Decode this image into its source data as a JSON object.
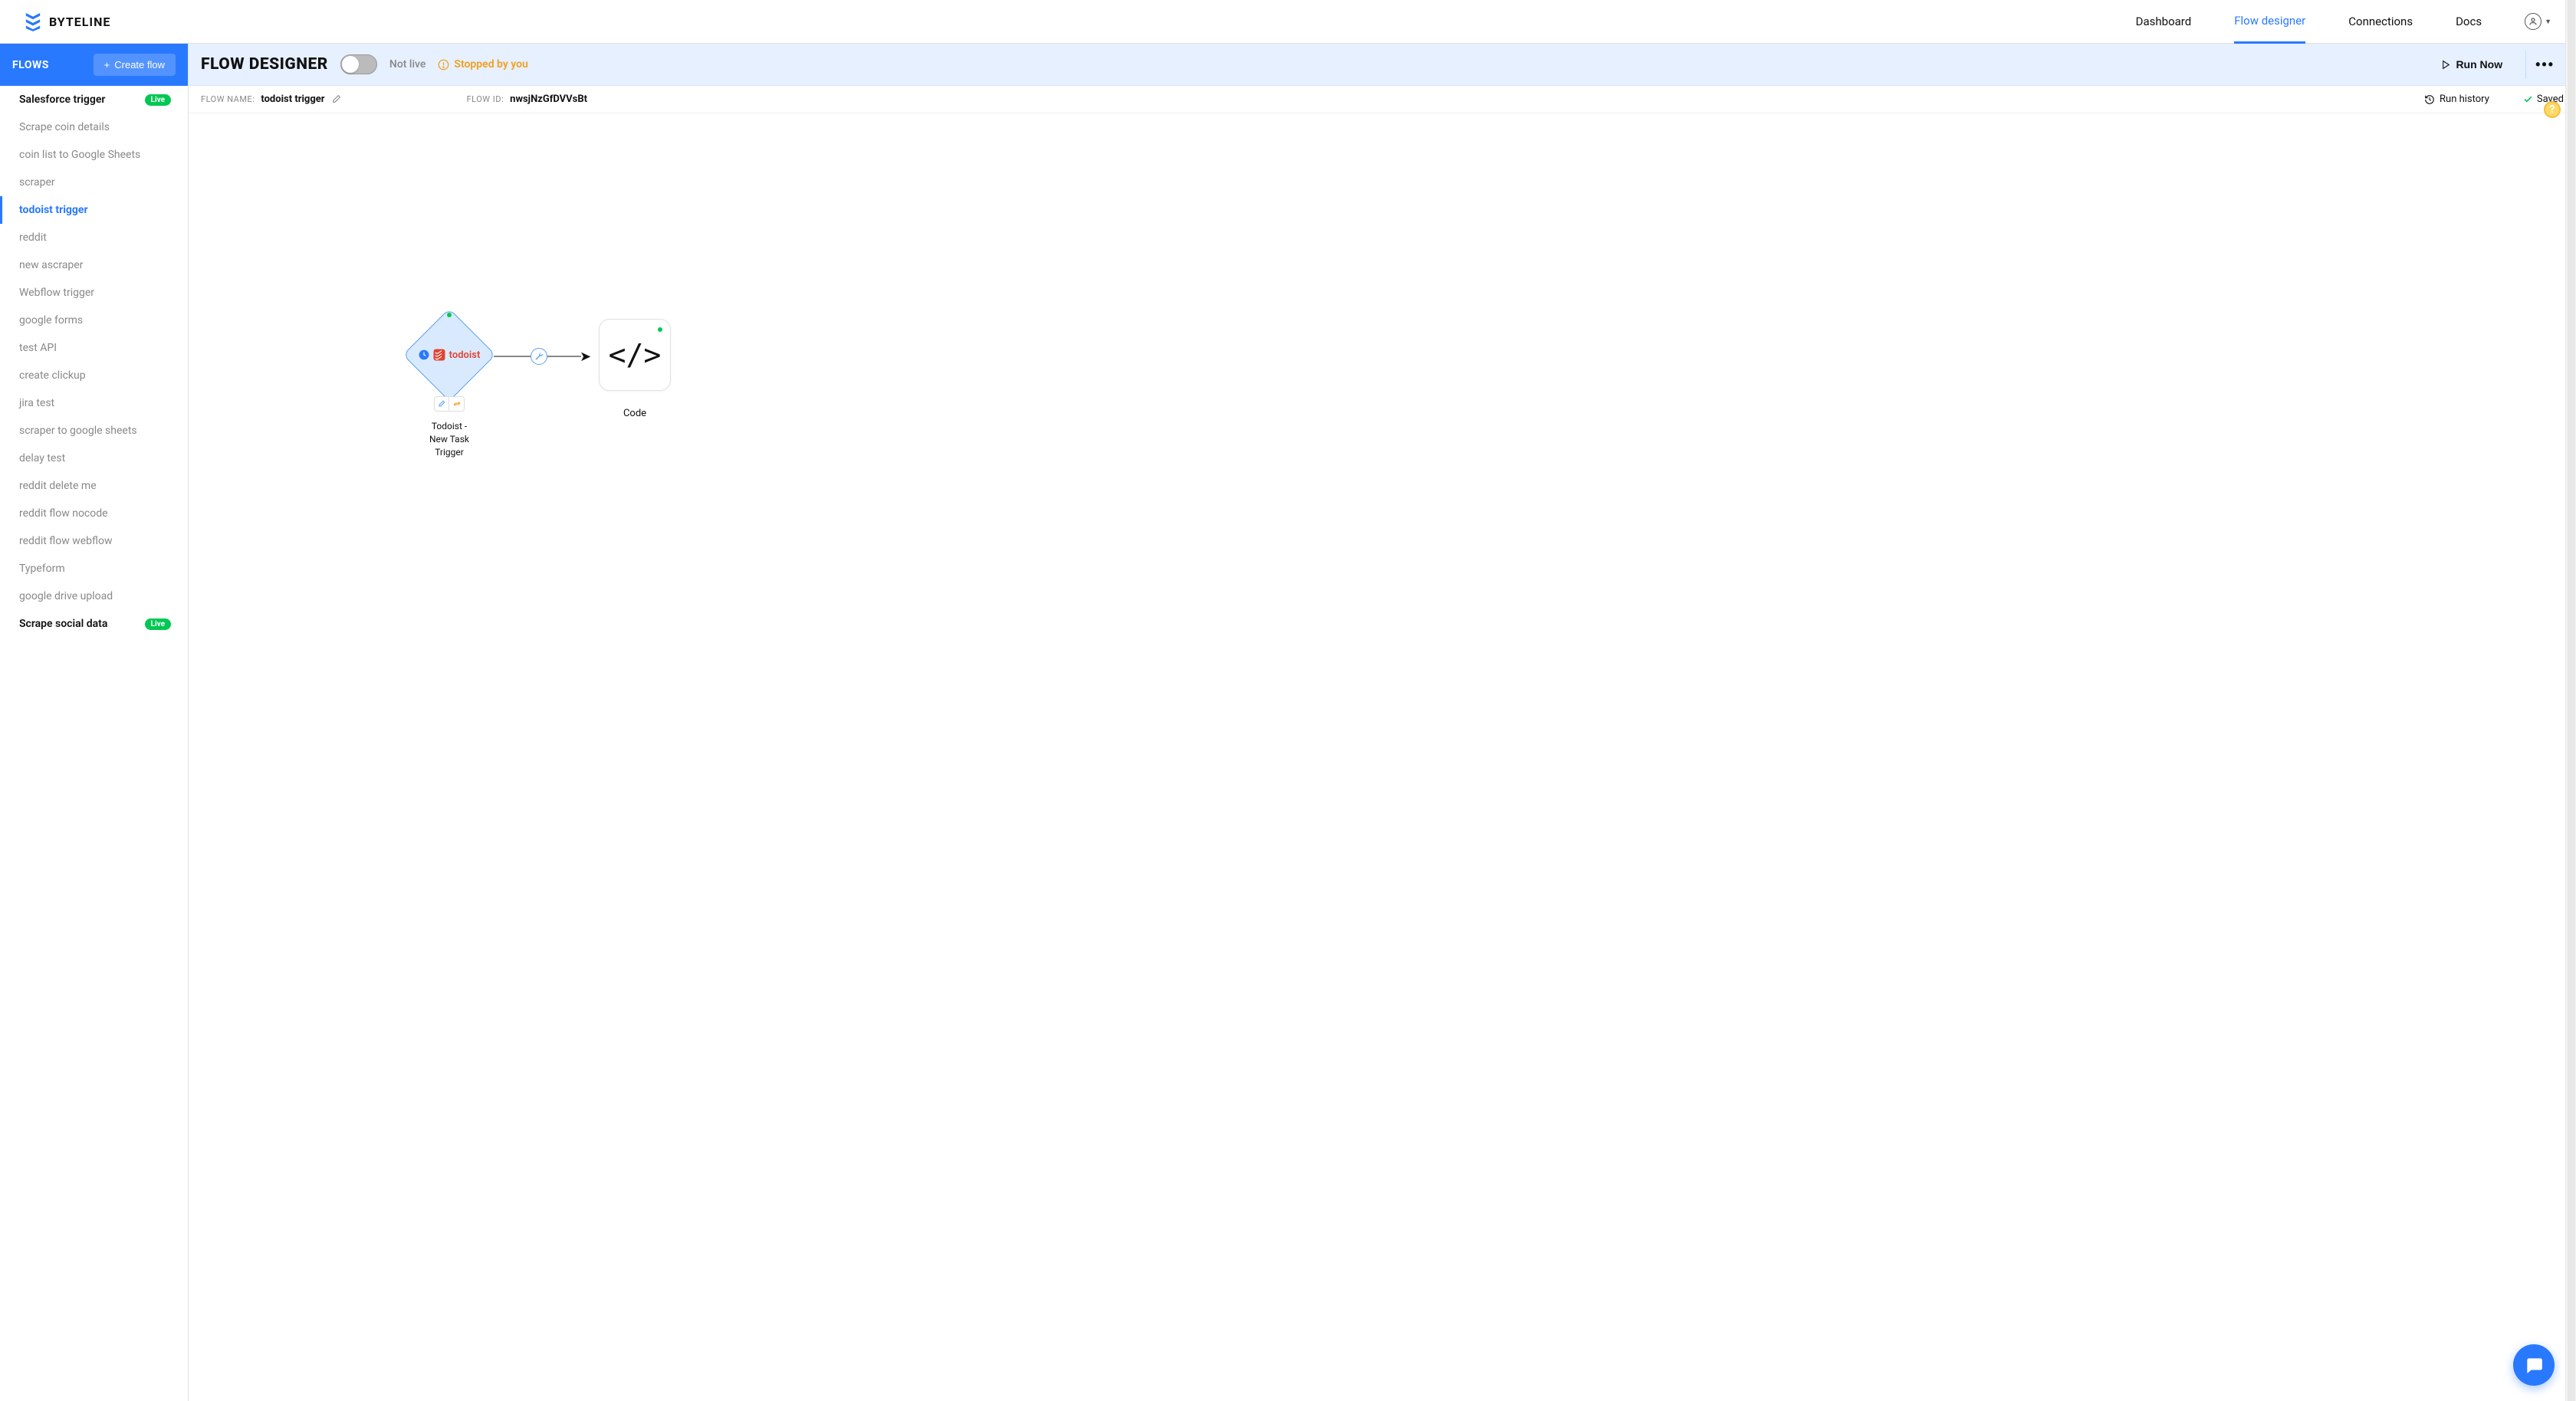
{
  "brand": {
    "name": "BYTELINE"
  },
  "nav": {
    "items": [
      {
        "label": "Dashboard",
        "active": false
      },
      {
        "label": "Flow designer",
        "active": true
      },
      {
        "label": "Connections",
        "active": false
      },
      {
        "label": "Docs",
        "active": false
      }
    ]
  },
  "sidebar": {
    "title": "FLOWS",
    "create_label": "Create flow",
    "items": [
      {
        "label": "Salesforce trigger",
        "live": true,
        "bold": true,
        "active": false
      },
      {
        "label": "Scrape coin details",
        "live": false,
        "bold": false,
        "active": false
      },
      {
        "label": "coin list to Google Sheets",
        "live": false,
        "bold": false,
        "active": false
      },
      {
        "label": "scraper",
        "live": false,
        "bold": false,
        "active": false
      },
      {
        "label": "todoist trigger",
        "live": false,
        "bold": false,
        "active": true
      },
      {
        "label": "reddit",
        "live": false,
        "bold": false,
        "active": false
      },
      {
        "label": "new ascraper",
        "live": false,
        "bold": false,
        "active": false
      },
      {
        "label": "Webflow trigger",
        "live": false,
        "bold": false,
        "active": false
      },
      {
        "label": "google forms",
        "live": false,
        "bold": false,
        "active": false
      },
      {
        "label": "test API",
        "live": false,
        "bold": false,
        "active": false
      },
      {
        "label": "create clickup",
        "live": false,
        "bold": false,
        "active": false
      },
      {
        "label": "jira test",
        "live": false,
        "bold": false,
        "active": false
      },
      {
        "label": "scraper to google sheets",
        "live": false,
        "bold": false,
        "active": false
      },
      {
        "label": "delay test",
        "live": false,
        "bold": false,
        "active": false
      },
      {
        "label": "reddit delete me",
        "live": false,
        "bold": false,
        "active": false
      },
      {
        "label": "reddit flow nocode",
        "live": false,
        "bold": false,
        "active": false
      },
      {
        "label": "reddit flow webflow",
        "live": false,
        "bold": false,
        "active": false
      },
      {
        "label": "Typeform",
        "live": false,
        "bold": false,
        "active": false
      },
      {
        "label": "google drive upload",
        "live": false,
        "bold": false,
        "active": false
      },
      {
        "label": "Scrape social data",
        "live": true,
        "bold": true,
        "active": false
      }
    ],
    "live_badge_text": "Live"
  },
  "designer": {
    "title": "FLOW DESIGNER",
    "status_notlive": "Not live",
    "status_stopped": "Stopped by you",
    "run_now_label": "Run Now",
    "flow_name_label": "FLOW NAME:",
    "flow_name_value": "todoist trigger",
    "flow_id_label": "FLOW ID:",
    "flow_id_value": "nwsjNzGfDVVsBt",
    "run_history_label": "Run history",
    "saved_label": "Saved"
  },
  "canvas": {
    "trigger_node": {
      "service": "todoist",
      "label": "Todoist - New Task Trigger"
    },
    "code_node": {
      "label": "Code"
    }
  },
  "colors": {
    "primary": "#2979ff",
    "success": "#00c853",
    "warning": "#f0a020"
  }
}
